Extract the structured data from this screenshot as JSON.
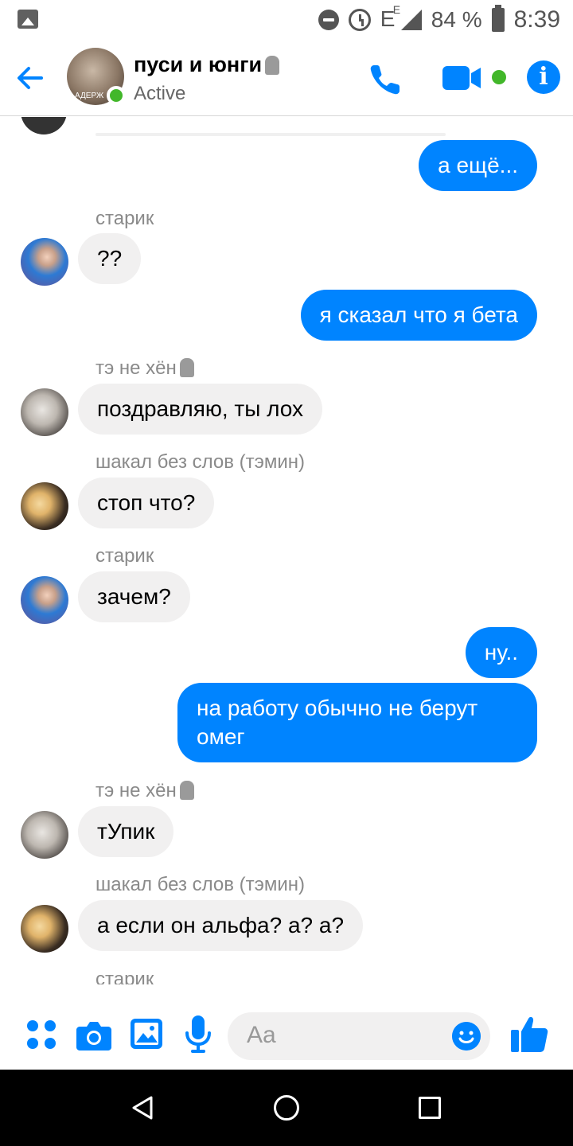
{
  "status_bar": {
    "network": "E",
    "network_sup": "E",
    "battery_percent": "84 %",
    "time": "8:39"
  },
  "header": {
    "title": "пуси и юнги",
    "status": "Active",
    "avatar_caption": "АДЕРЖ"
  },
  "messages": [
    {
      "dir": "out",
      "text": "а ещё..."
    },
    {
      "dir": "in",
      "sender": "старик",
      "text": "??"
    },
    {
      "dir": "out",
      "text": "я сказал что я бета"
    },
    {
      "dir": "in",
      "sender": "тэ не хён",
      "text": "поздравляю, ты лох"
    },
    {
      "dir": "in",
      "sender": "шакал без слов (тэмин)",
      "text": "стоп что?"
    },
    {
      "dir": "in",
      "sender": "старик",
      "text": "зачем?"
    },
    {
      "dir": "out",
      "text": "ну.."
    },
    {
      "dir": "out",
      "text_line1": "на работу обычно не берут",
      "text_line2": "омег"
    },
    {
      "dir": "in",
      "sender": "тэ не хён",
      "text": "тУпик"
    },
    {
      "dir": "in",
      "sender": "шакал без слов (тэмин)",
      "text": "а если он альфа? а? а?"
    },
    {
      "dir": "in",
      "sender": "старик"
    }
  ],
  "composer": {
    "placeholder": "Aa"
  },
  "colors": {
    "accent": "#0084ff",
    "incoming_bubble": "#f1f0f0",
    "active_green": "#42b72a"
  },
  "icons": [
    "back-arrow-icon",
    "phone-icon",
    "video-camera-icon",
    "info-icon",
    "more-apps-icon",
    "camera-icon",
    "gallery-icon",
    "microphone-icon",
    "emoji-icon",
    "thumbs-up-icon",
    "nav-back-icon",
    "nav-home-icon",
    "nav-recents-icon"
  ]
}
